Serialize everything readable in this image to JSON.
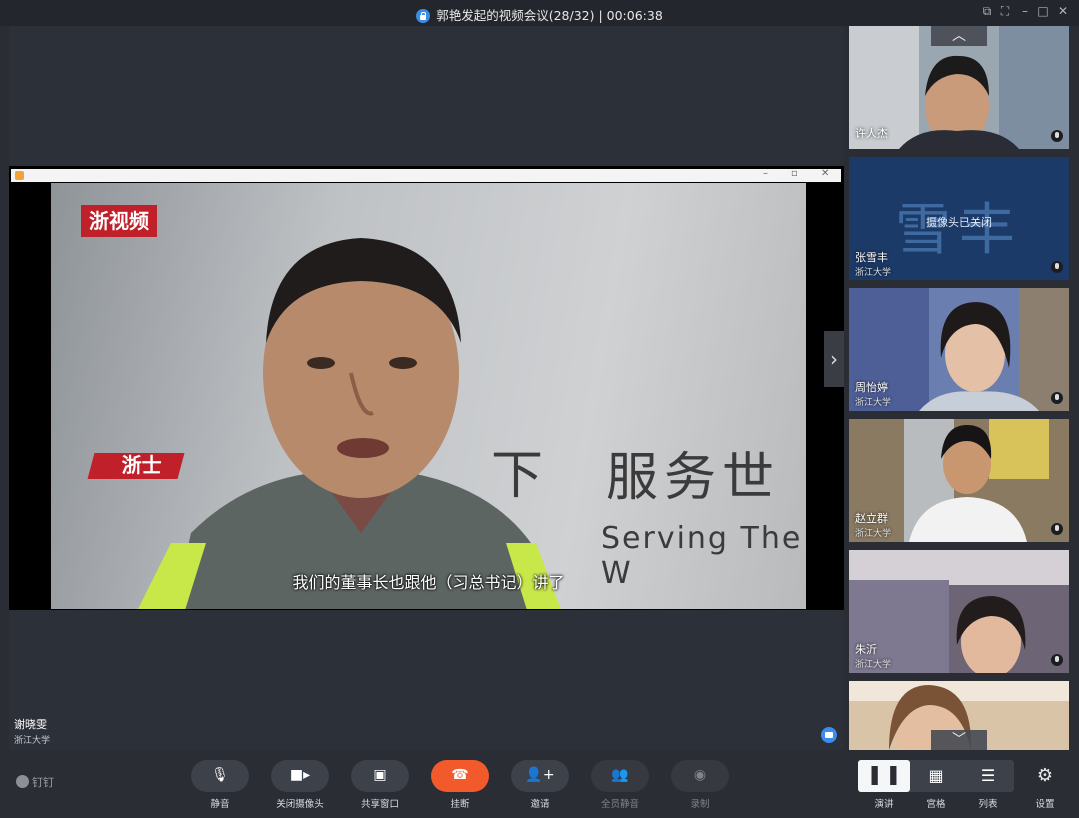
{
  "window": {
    "title": "郭艳发起的视频会议(28/32) | 00:06:38"
  },
  "stage": {
    "logo_text": "浙视频",
    "badge_text": "浙士",
    "wall_text_cn_left": "下",
    "wall_text_cn": "服务世",
    "wall_text_en": "Serving The W",
    "subtitle": "我们的董事长也跟他（习总书记）讲了",
    "speaker_name": "谢晓雯",
    "speaker_org": "浙江大学"
  },
  "participants": [
    {
      "name": "许人杰",
      "org": "",
      "camera_off": false,
      "bg": "#8d9aa6"
    },
    {
      "name": "张雪丰",
      "org": "浙江大学",
      "camera_off": true,
      "avatar_text": "雪丰",
      "cam_off_text": "摄像头已关闭",
      "bg": "#1c3a68"
    },
    {
      "name": "周怡婷",
      "org": "浙江大学",
      "camera_off": false,
      "bg": "#5b6fa8"
    },
    {
      "name": "赵立群",
      "org": "浙江大学",
      "camera_off": false,
      "bg": "#a68a5e"
    },
    {
      "name": "朱沂",
      "org": "浙江大学",
      "camera_off": false,
      "bg": "#6b5a74"
    },
    {
      "name": "",
      "org": "",
      "camera_off": false,
      "bg": "#d9c4a8"
    }
  ],
  "toolbar": {
    "brand": "钉钉",
    "mute": "静音",
    "camera_off": "关闭摄像头",
    "share_window": "共享窗口",
    "hangup": "挂断",
    "invite": "邀请",
    "mute_all": "全员静音",
    "record": "录制",
    "layout_speaker": "演讲",
    "layout_grid": "宫格",
    "layout_list": "列表",
    "settings": "设置"
  },
  "colors": {
    "background": "#2a2d34",
    "hangup": "#f25a2b",
    "accent": "#3a8de6"
  }
}
